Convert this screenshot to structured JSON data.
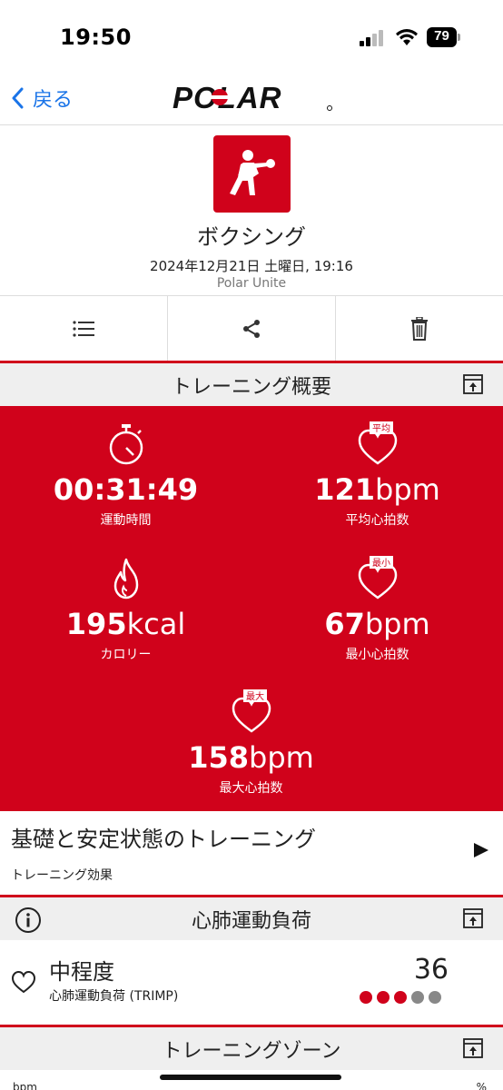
{
  "status_bar": {
    "time": "19:50",
    "battery": "79"
  },
  "nav": {
    "back_label": "戻る",
    "brand": "POLAR"
  },
  "activity": {
    "name": "ボクシング",
    "datetime": "2024年12月21日 土曜日, 19:16",
    "source": "Polar Unite",
    "icon": "boxing-icon",
    "icon_color": "#d0021b"
  },
  "actions": [
    {
      "icon": "list-icon"
    },
    {
      "icon": "share-icon"
    },
    {
      "icon": "trash-icon"
    }
  ],
  "summary": {
    "title": "トレーニング概要",
    "duration": {
      "value": "00:31:49",
      "label": "運動時間"
    },
    "avg_hr": {
      "value": "121",
      "unit": "bpm",
      "label": "平均心拍数",
      "badge": "平均"
    },
    "calories": {
      "value": "195",
      "unit": "kcal",
      "label": "カロリー"
    },
    "min_hr": {
      "value": "67",
      "unit": "bpm",
      "label": "最小心拍数",
      "badge": "最小"
    },
    "max_hr": {
      "value": "158",
      "unit": "bpm",
      "label": "最大心拍数",
      "badge": "最大"
    }
  },
  "benefit": {
    "title": "基礎と安定状態のトレーニング",
    "subtitle": "トレーニング効果"
  },
  "cardio_load": {
    "title": "心肺運動負荷",
    "level": "中程度",
    "subtitle": "心肺運動負荷 (TRIMP)",
    "value": "36",
    "dots_on": 3,
    "dots_total": 5
  },
  "zones": {
    "title": "トレーニングゾーン",
    "left_label": "bpm",
    "right_label": "%"
  },
  "colors": {
    "accent": "#d0021b",
    "link": "#1a74e8",
    "header_bg": "#efefef"
  }
}
